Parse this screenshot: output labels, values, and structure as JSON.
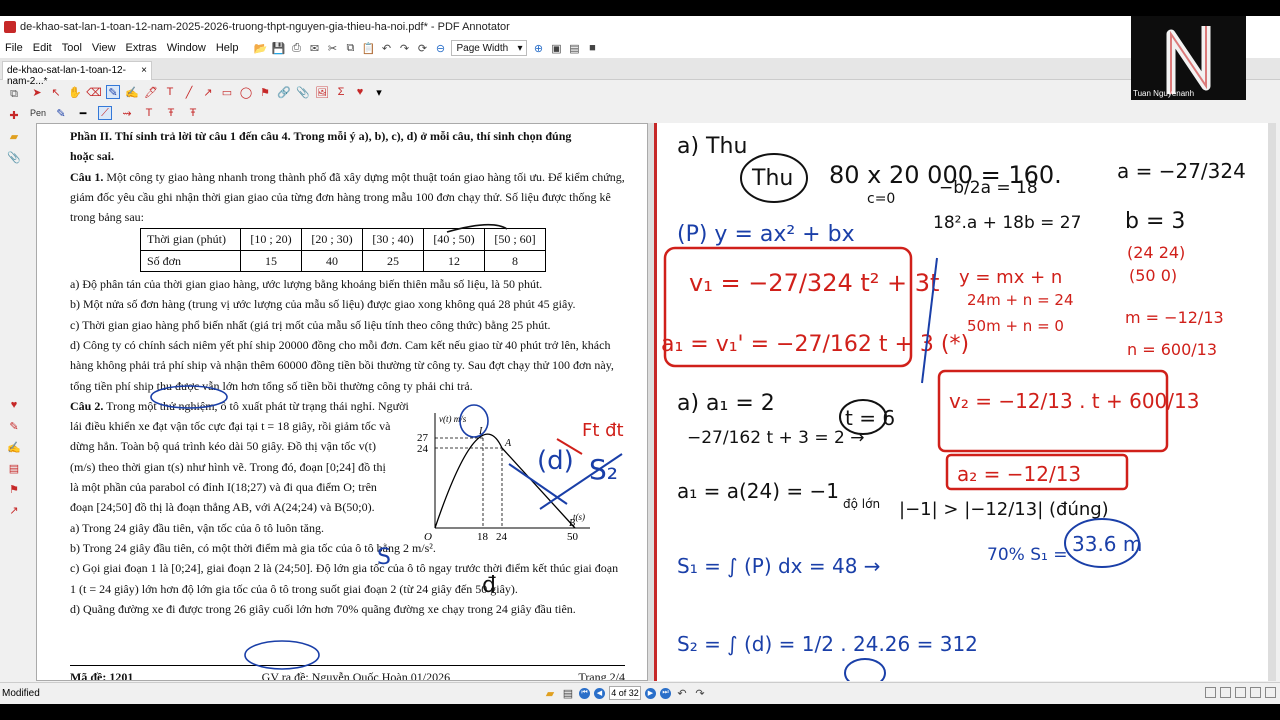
{
  "window": {
    "title": "de-khao-sat-lan-1-toan-12-nam-2025-2026-truong-thpt-nguyen-gia-thieu-ha-noi.pdf* - PDF Annotator"
  },
  "menu": [
    "File",
    "Edit",
    "Tool",
    "View",
    "Extras",
    "Window",
    "Help"
  ],
  "zoom": {
    "label": "Page Width"
  },
  "tab": {
    "label": "de-khao-sat-lan-1-toan-12-nam-2...*",
    "close": "×"
  },
  "tool": {
    "label": "Pen"
  },
  "webcam": {
    "name": "Tuan Nguyenanh"
  },
  "document": {
    "part_header": "Phần II. Thí sinh trả lời từ câu 1 đến câu 4. Trong mỗi ý a), b), c), d) ở mỗi câu, thí sinh chọn đúng",
    "part_header2": "hoặc sai.",
    "q1_label": "Câu 1.",
    "q1_text": " Một công ty giao hàng nhanh trong thành phố đã xây dựng một thuật toán giao hàng tối ưu. Để kiểm chứng, giám đốc yêu cầu ghi nhận thời gian giao của từng đơn hàng trong mẫu 100 đơn chạy thử. Số liệu được thống kê trong bảng sau:",
    "table": {
      "header": [
        "Thời gian (phút)",
        "[10 ; 20)",
        "[20 ; 30)",
        "[30 ; 40)",
        "[40 ; 50)",
        "[50 ; 60]"
      ],
      "row": [
        "Số đơn",
        "15",
        "40",
        "25",
        "12",
        "8"
      ]
    },
    "q1a": "a) Độ phân tán của thời gian giao hàng, ước lượng bằng khoảng biến thiên mẫu số liệu, là 50 phút.",
    "q1b": "b) Một nửa số đơn hàng (trung vị ước lượng của mẫu số liệu) được giao xong không quá 28 phút 45 giây.",
    "q1c": "c) Thời gian giao hàng phổ biến nhất (giá trị mốt của mẫu số liệu tính theo công thức) bằng 25 phút.",
    "q1d": "d) Công ty có chính sách niêm yết phí ship 20000 đồng cho mỗi đơn. Cam kết nếu giao từ 40 phút trở lên, khách hàng không phải trả phí ship và nhận thêm 60000 đồng tiền bồi thường từ công ty. Sau đợt chạy thử 100 đơn này, tổng tiền phí ship thu được vẫn lớn hơn tổng số tiền bồi thường công ty phải chi trả.",
    "q2_label": "Câu 2.",
    "q2_l1": " Trong một thử nghiệm, ô tô xuất phát từ trạng thái nghỉ. Người",
    "q2_l2": "lái điều khiển xe đạt vận tốc cực đại tại t = 18 giây, rồi giảm tốc và",
    "q2_l3": "dừng hẳn. Toàn bộ quá trình kéo dài 50 giây. Đồ thị vận tốc v(t)",
    "q2_l4": "(m/s) theo thời gian t(s) như hình vẽ. Trong đó, đoạn [0;24] đồ thị",
    "q2_l5": "là một phần của parabol có đỉnh I(18;27) và đi qua điểm O; trên",
    "q2_l6": "đoạn [24;50] đồ thị là đoạn thẳng AB, với A(24;24) và B(50;0).",
    "q2a": "a) Trong 24 giây đầu tiên, vận tốc của ô tô luôn tăng.",
    "q2b": "b) Trong 24 giây đầu tiên, có một thời điểm mà gia tốc của ô tô bằng 2 m/s².",
    "q2c": "c) Gọi giai đoạn 1 là [0;24], giai đoạn 2 là (24;50]. Độ lớn gia tốc của ô tô ngay trước thời điểm kết thúc giai đoạn 1 (t = 24 giây) lớn hơn độ lớn gia tốc của ô tô trong suốt giai đoạn 2 (từ 24 giây đến 50 giây).",
    "q2d": "d) Quãng đường xe đi được trong 26 giây cuối lớn hơn 70% quãng đường xe chạy trong 24 giây đầu tiên.",
    "footer_code": "Mã đề: 1201",
    "footer_author": "GV ra đề: Nguyễn Quốc Hoàn   01/2026",
    "footer_page": "Trang 2/4",
    "graph": {
      "ylabel": "v(t) m/s",
      "xlabel": "t(s)",
      "y27": "27",
      "y24": "24",
      "x18": "18",
      "x24": "24",
      "x50": "50",
      "O": "O",
      "I": "I",
      "A": "A",
      "B": "B"
    }
  },
  "handwriting": {
    "h1": "a)   Thu",
    "h2": "Thu",
    "h3": "80 x 20 000 = 160.",
    "h4": "c=0",
    "h5": "−b/2a = 18",
    "h6": "18².a + 18b = 27",
    "h7": "a = −27/324",
    "h8": "b = 3",
    "h9": "(P)  y = ax² + bx",
    "h10": "(24 24)",
    "h11": "(50 0)",
    "h12": "v₁ = −27/324 t² + 3t",
    "h13": "y = mx + n",
    "h14": "24m + n = 24",
    "h15": "50m + n = 0",
    "h16": "m = −12/13",
    "h17": "n = 600/13",
    "h18": "a₁ = v₁' = −27/162 t + 3 (*)",
    "h19": "v₂ = −12/13 . t + 600/13",
    "h20": "a)   a₁ = 2",
    "h21": "−27/162 t + 3 = 2 →",
    "h22": "t = 6",
    "h23": "a₂ = −12/13",
    "h24": "a₁ = a(24) = −1",
    "h25": "độ lớn",
    "h26": "|−1| > |−12/13| (đúng)",
    "h27": "S₁ = ∫ (P) dx  = 48 →",
    "h28": "70% S₁ =",
    "h29": "33.6 m",
    "h30": "S₂ = ∫ (d) = 1/2 . 24.26 = 312",
    "h31": "(d)",
    "h32": "S₂",
    "h33": "Ft đt",
    "h34": "đ",
    "h35": "S"
  },
  "status": {
    "text": "Modified",
    "page": "4 of 32"
  },
  "colors": {
    "ink_blue": "#1a3fa8",
    "ink_red": "#d0201a",
    "ink_black": "#111111"
  }
}
